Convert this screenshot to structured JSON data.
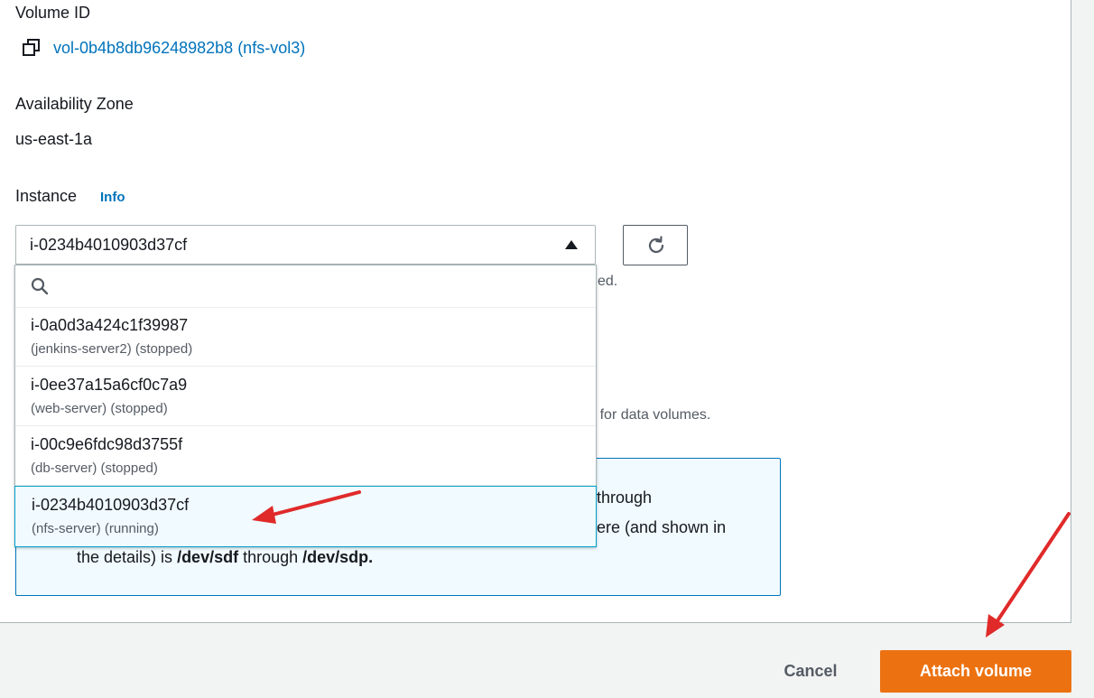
{
  "volume_id": {
    "label": "Volume ID",
    "value": "vol-0b4b8db96248982b8 (nfs-vol3)"
  },
  "availability_zone": {
    "label": "Availability Zone",
    "value": "us-east-1a"
  },
  "instance": {
    "label": "Instance",
    "info_link": "Info",
    "selected": "i-0234b4010903d37cf",
    "options": [
      {
        "id": "i-0a0d3a424c1f39987",
        "desc": "(jenkins-server2) (stopped)"
      },
      {
        "id": "i-0ee37a15a6cf0c7a9",
        "desc": "(web-server) (stopped)"
      },
      {
        "id": "i-00c9e6fdc98d3755f",
        "desc": "(db-server) (stopped)"
      },
      {
        "id": "i-0234b4010903d37cf",
        "desc": "(nfs-server) (running)"
      }
    ]
  },
  "background_fragments": {
    "hint1": "ed.",
    "hint2": "| for data volumes."
  },
  "alert": {
    "line1_end": "through",
    "line2_end": "ere (and shown in",
    "line3_prefix": "the details) is ",
    "line3_bold1": "/dev/sdf",
    "line3_mid": " through ",
    "line3_bold2": "/dev/sdp."
  },
  "footer": {
    "cancel_label": "Cancel",
    "attach_label": "Attach volume"
  },
  "colors": {
    "link": "#0073bb",
    "primary_button": "#ec7211",
    "annotation_arrow": "#e02a2a"
  },
  "icons": [
    "copy-icon",
    "refresh-icon",
    "search-icon",
    "caret-up-icon"
  ]
}
